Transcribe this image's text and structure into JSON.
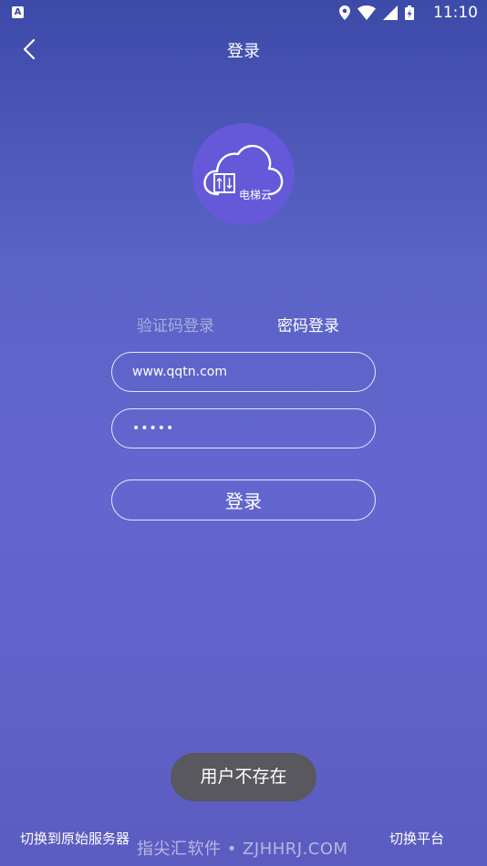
{
  "status_bar": {
    "app_badge": "A",
    "time": "11:10",
    "icons": [
      "location-icon",
      "wifi-icon",
      "signal-icon",
      "battery-charging-icon"
    ]
  },
  "header": {
    "title": "登录",
    "back_icon": "chevron-left-icon"
  },
  "logo": {
    "text": "电梯云",
    "icon": "cloud-elevator-icon",
    "color": "#6558d9"
  },
  "tabs": [
    {
      "label": "验证码登录",
      "active": false
    },
    {
      "label": "密码登录",
      "active": true
    }
  ],
  "form": {
    "username_value": "www.qqtn.com",
    "password_value": "•••••"
  },
  "login_button": {
    "label": "登录"
  },
  "toast": {
    "text": "用户不存在"
  },
  "footer": {
    "switch_original": "切换到原始服务器",
    "switch_platform": "切换平台"
  },
  "watermark": "指尖汇软件 • ZJHHRJ.COM"
}
